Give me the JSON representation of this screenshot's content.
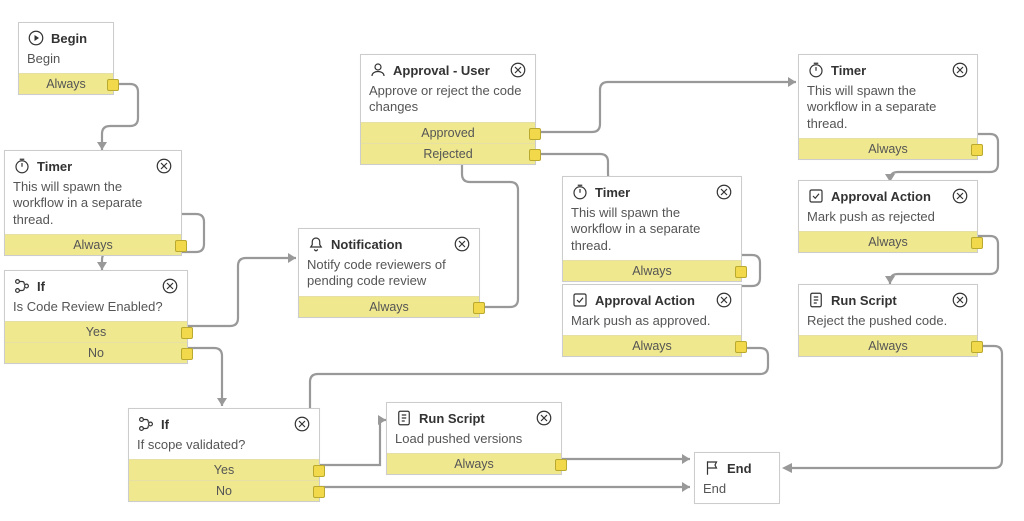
{
  "nodes": {
    "begin": {
      "title": "Begin",
      "desc": "Begin",
      "outs": [
        "Always"
      ]
    },
    "timer1": {
      "title": "Timer",
      "desc": "This will spawn the workflow in a separate thread.",
      "outs": [
        "Always"
      ]
    },
    "if1": {
      "title": "If",
      "desc": "Is Code Review Enabled?",
      "outs": [
        "Yes",
        "No"
      ]
    },
    "notification": {
      "title": "Notification",
      "desc": "Notify code reviewers of pending code review",
      "outs": [
        "Always"
      ]
    },
    "approvalUser": {
      "title": "Approval - User",
      "desc": "Approve or reject the code changes",
      "outs": [
        "Approved",
        "Rejected"
      ]
    },
    "timer2": {
      "title": "Timer",
      "desc": "This will spawn the workflow in a separate thread.",
      "outs": [
        "Always"
      ]
    },
    "approvalAction1": {
      "title": "Approval Action",
      "desc": "Mark push as approved.",
      "outs": [
        "Always"
      ]
    },
    "timer3": {
      "title": "Timer",
      "desc": "This will spawn the workflow in a separate thread.",
      "outs": [
        "Always"
      ]
    },
    "approvalAction2": {
      "title": "Approval Action",
      "desc": "Mark push as rejected",
      "outs": [
        "Always"
      ]
    },
    "runScriptReject": {
      "title": "Run Script",
      "desc": "Reject the pushed code.",
      "outs": [
        "Always"
      ]
    },
    "if2": {
      "title": "If",
      "desc": "If scope validated?",
      "outs": [
        "Yes",
        "No"
      ]
    },
    "runScriptLoad": {
      "title": "Run Script",
      "desc": "Load pushed versions",
      "outs": [
        "Always"
      ]
    },
    "end": {
      "title": "End",
      "desc": "End"
    }
  },
  "colors": {
    "outBg": "#fcf9d8",
    "outSel": "#efe88f",
    "border": "#ccc",
    "conn": "#999"
  }
}
